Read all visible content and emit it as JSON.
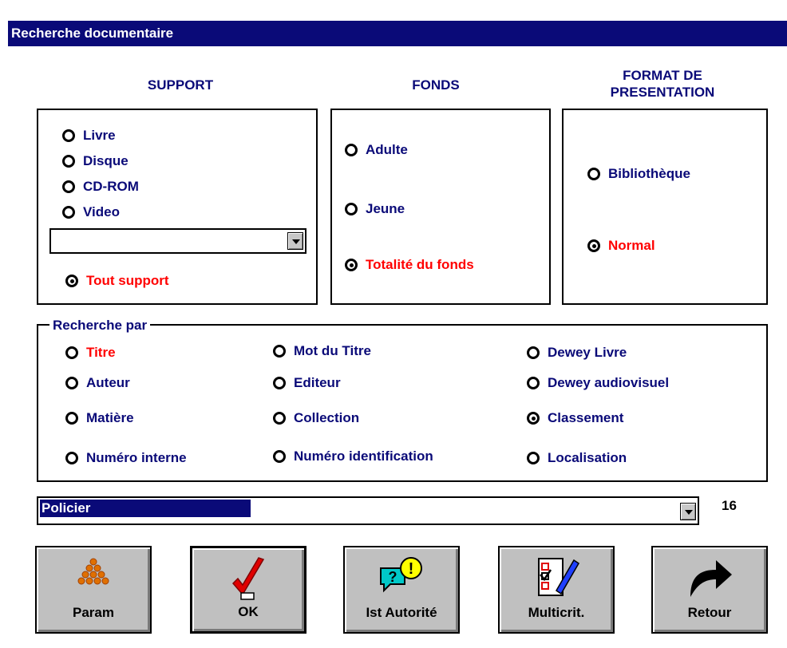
{
  "window": {
    "title": "Recherche documentaire"
  },
  "headers": {
    "support": "SUPPORT",
    "fonds": "FONDS",
    "format_line1": "FORMAT DE",
    "format_line2": "PRESENTATION"
  },
  "support": {
    "options": [
      "Livre",
      "Disque",
      "CD-ROM",
      "Video"
    ],
    "combo_value": "",
    "all_label": "Tout support",
    "selected": "Tout support"
  },
  "fonds": {
    "options": [
      "Adulte",
      "Jeune",
      "Totalité du fonds"
    ],
    "selected": "Totalité du fonds"
  },
  "format": {
    "options": [
      "Bibliothèque",
      "Normal"
    ],
    "selected": "Normal"
  },
  "recherche_par": {
    "legend": "Recherche par",
    "col1": [
      "Titre",
      "Auteur",
      "Matière",
      "Numéro interne"
    ],
    "col2": [
      "Mot du Titre",
      "Editeur",
      "Collection",
      "Numéro identification"
    ],
    "col3": [
      "Dewey Livre",
      "Dewey audiovisuel",
      "Classement",
      "Localisation"
    ],
    "selected": "Classement"
  },
  "value_combo": {
    "value": "Policier",
    "count": "16"
  },
  "buttons": {
    "param": "Param",
    "ok": "OK",
    "autorite": "Ist Autorité",
    "multicrit": "Multicrit.",
    "retour": "Retour"
  },
  "colors": {
    "title_bg": "#0a0a78",
    "label_text": "#0a0a78",
    "highlight": "#ff0000",
    "button_face": "#c0c0c0"
  }
}
